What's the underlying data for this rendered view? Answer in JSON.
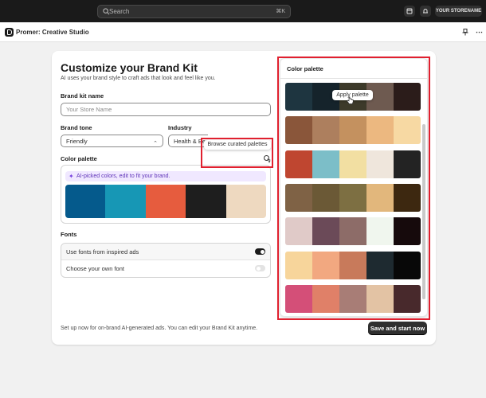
{
  "topbar": {
    "search_placeholder": "Search",
    "shortcut": "⌘K",
    "store_label": "YOUR STORENAME",
    "icons": [
      "search-icon",
      "store-icon",
      "bell-icon"
    ]
  },
  "appbar": {
    "title": "Promer: Creative Studio",
    "icons": [
      "pin-icon",
      "more-icon"
    ]
  },
  "form": {
    "title": "Customize your Brand Kit",
    "subtitle": "AI uses your brand style to craft ads that look and feel like you.",
    "brand_kit_label": "Brand kit name",
    "brand_kit_placeholder": "Your Store Name",
    "brand_tone_label": "Brand tone",
    "brand_tone_value": "Friendly",
    "industry_label": "Industry",
    "industry_value": "Health & Bea",
    "color_palette_label": "Color palette",
    "ai_banner": "AI-picked colors, edit to fit your brand.",
    "current_palette": [
      "#055a8c",
      "#1797b5",
      "#e65c3e",
      "#1e1e1e",
      "#eed9c0"
    ],
    "fonts_label": "Fonts",
    "font_option_1": "Use fonts from inspired ads",
    "font_option_1_on": true,
    "font_option_2": "Choose your own font",
    "font_option_2_on": false,
    "footnote": "Set up now for on-brand AI-generated ads. You can edit your Brand Kit anytime.",
    "save_button": "Save and start now",
    "tooltip": "Browse curated palettes"
  },
  "panel": {
    "title": "Color palette",
    "apply_label": "Apply palette",
    "palettes": [
      [
        "#1e3540",
        "#15232b",
        "#3d3a2a",
        "#6e5a50",
        "#2b1c1a"
      ],
      [
        "#8a563a",
        "#ad7f5e",
        "#c4915f",
        "#ecb880",
        "#f7d9a3"
      ],
      [
        "#bf4630",
        "#7cbec8",
        "#f2dfa2",
        "#efe6dc",
        "#232323"
      ],
      [
        "#7f6245",
        "#6b5936",
        "#7d6f42",
        "#e2b77c",
        "#3d2810"
      ],
      [
        "#e0cac8",
        "#6b4a58",
        "#8d6c68",
        "#f0f6ee",
        "#160a0c"
      ],
      [
        "#f7d59b",
        "#f2a880",
        "#c87a5b",
        "#1e2a30",
        "#080808"
      ],
      [
        "#d44f78",
        "#e08068",
        "#a87d76",
        "#e3c3a4",
        "#48292c"
      ]
    ]
  },
  "colors": {
    "highlight": "#e0202f",
    "primary_button": "#303030",
    "ai_banner_bg": "#f0e8ff"
  }
}
